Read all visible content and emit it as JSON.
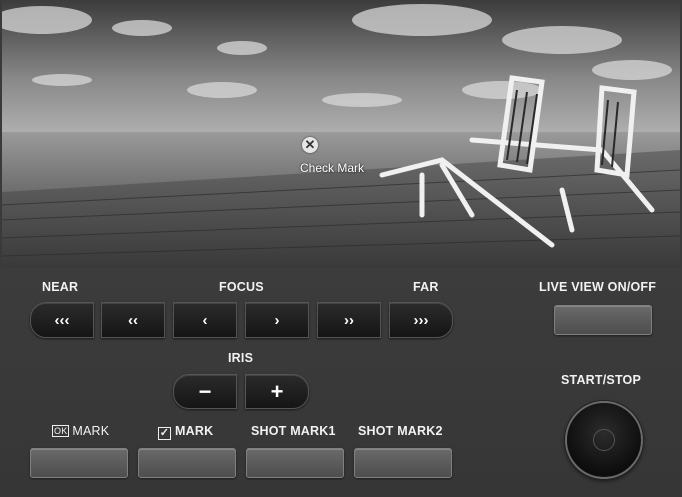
{
  "preview": {
    "overlay_icon": "close-circle-icon",
    "overlay_label": "Check Mark"
  },
  "focus": {
    "near_label": "NEAR",
    "title_label": "FOCUS",
    "far_label": "FAR",
    "buttons": [
      "‹‹‹",
      "‹‹",
      "‹",
      "›",
      "››",
      "›››"
    ]
  },
  "live_view": {
    "label": "LIVE  VIEW  ON/OFF"
  },
  "iris": {
    "label": "IRIS",
    "minus": "−",
    "plus": "+"
  },
  "marks": {
    "ok_icon": "OK",
    "ok_mark_label": "MARK",
    "check_icon": "✓",
    "check_mark_label": "MARK",
    "shot_mark1_label": "SHOT MARK1",
    "shot_mark2_label": "SHOT MARK2"
  },
  "record": {
    "label": "START/STOP"
  }
}
